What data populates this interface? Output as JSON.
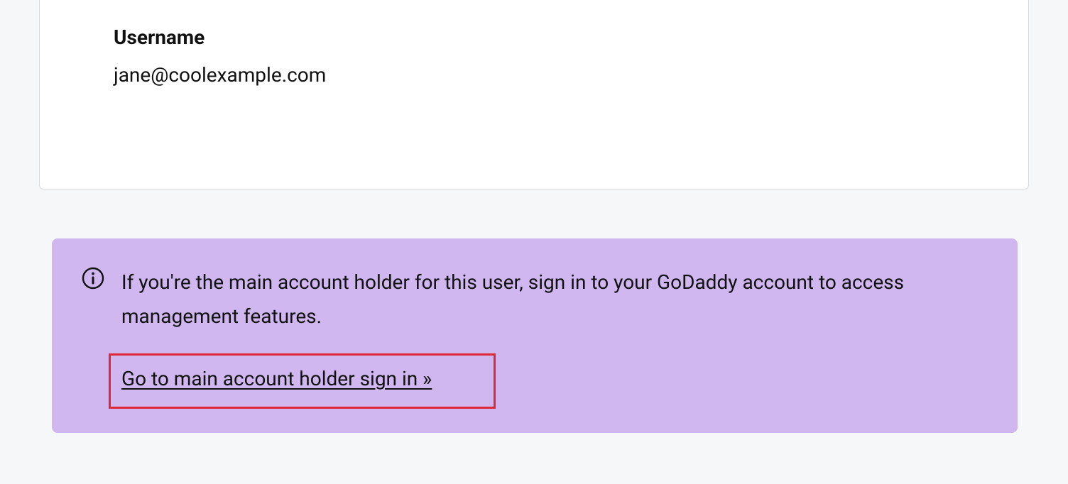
{
  "card": {
    "username_label": "Username",
    "username_value": "jane@coolexample.com"
  },
  "banner": {
    "message": "If you're the main account holder for this user, sign in to your GoDaddy account to access management features.",
    "link_text": "Go to main account holder sign in »"
  }
}
